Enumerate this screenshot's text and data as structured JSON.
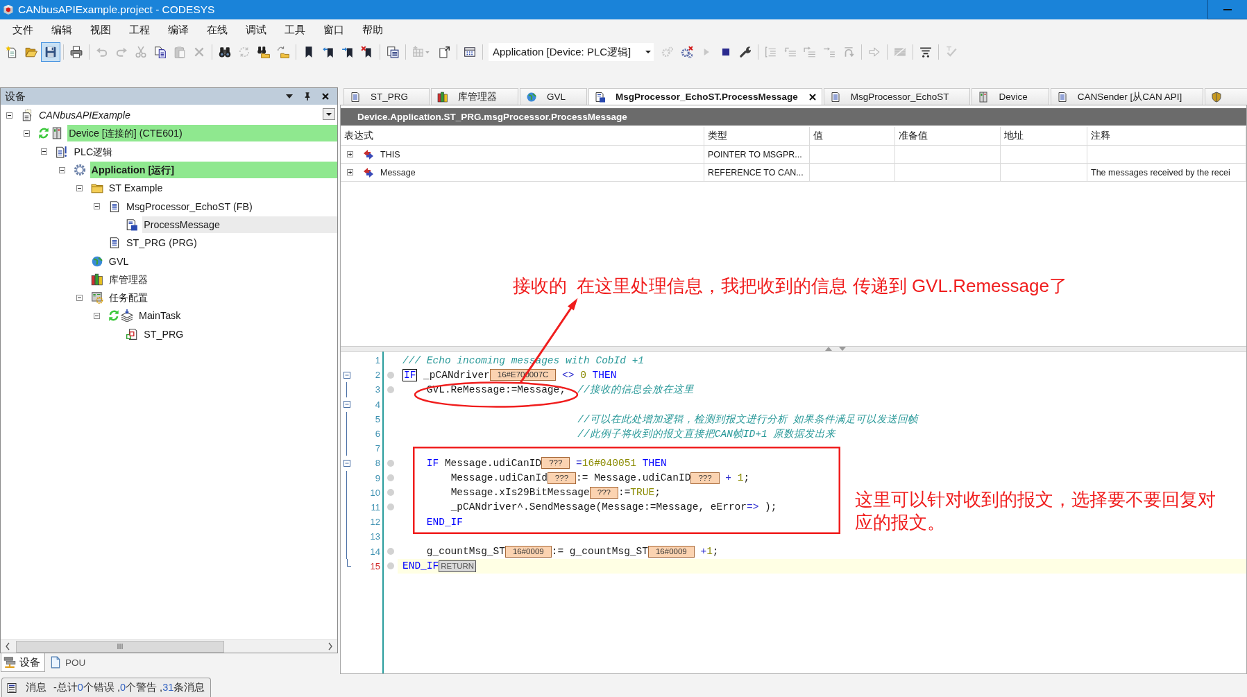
{
  "window": {
    "title": "CANbusAPIExample.project - CODESYS"
  },
  "menu": [
    "文件",
    "编辑",
    "视图",
    "工程",
    "编译",
    "在线",
    "调试",
    "工具",
    "窗口",
    "帮助"
  ],
  "toolbar": {
    "groups_left": [
      [
        {
          "disabled": false,
          "hovered": false
        },
        {
          "disabled": false,
          "hovered": false
        },
        {
          "disabled": false,
          "hovered": true
        }
      ],
      [
        {
          "disabled": false,
          "hovered": false
        }
      ],
      [
        {
          "disabled": true,
          "hovered": false
        },
        {
          "disabled": true,
          "hovered": false
        },
        {
          "disabled": true,
          "hovered": false
        },
        {
          "disabled": false,
          "hovered": false
        },
        {
          "disabled": true,
          "hovered": false
        },
        {
          "disabled": true,
          "hovered": false
        }
      ],
      [
        {
          "disabled": false,
          "hovered": false
        },
        {
          "disabled": true,
          "hovered": false
        },
        {
          "disabled": false,
          "hovered": false
        },
        {
          "disabled": false,
          "hovered": false
        }
      ],
      [
        {
          "disabled": false,
          "hovered": false
        },
        {
          "disabled": false,
          "hovered": false
        },
        {
          "disabled": false,
          "hovered": false
        },
        {
          "disabled": false,
          "hovered": false
        }
      ],
      [
        {
          "disabled": false,
          "hovered": false
        }
      ],
      [
        {
          "disabled": true,
          "hovered": false
        },
        {
          "disabled": false,
          "hovered": false
        }
      ],
      [
        {
          "disabled": false,
          "hovered": false
        }
      ]
    ],
    "application_selector": "Application [Device: PLC逻辑]",
    "groups_right": [
      [
        {
          "disabled": true,
          "hovered": false
        },
        {
          "disabled": false,
          "hovered": false
        },
        {
          "disabled": true,
          "hovered": false
        },
        {
          "disabled": false,
          "hovered": false
        },
        {
          "disabled": false,
          "hovered": false
        }
      ],
      [
        {
          "disabled": true,
          "hovered": false
        },
        {
          "disabled": true,
          "hovered": false
        },
        {
          "disabled": true,
          "hovered": false
        },
        {
          "disabled": true,
          "hovered": false
        },
        {
          "disabled": true,
          "hovered": false
        }
      ],
      [
        {
          "disabled": true,
          "hovered": false
        }
      ],
      [
        {
          "disabled": true,
          "hovered": false
        }
      ],
      [
        {
          "disabled": false,
          "hovered": false
        }
      ],
      [
        {
          "disabled": true,
          "hovered": false
        }
      ]
    ]
  },
  "devices_panel": {
    "title": "设备",
    "tree": [
      {
        "label": "CANbusAPIExample",
        "kind": "project",
        "expanded": true,
        "online": false,
        "highlighted": false,
        "selected": false,
        "children": [
          {
            "label": "Device [连接的] (CTE601)",
            "kind": "device",
            "expanded": true,
            "online": true,
            "highlighted": true,
            "selected": false,
            "children": [
              {
                "label": "PLC逻辑",
                "kind": "plc-logic",
                "expanded": true,
                "online": false,
                "highlighted": false,
                "selected": false,
                "children": [
                  {
                    "label": "Application [运行]",
                    "kind": "application",
                    "expanded": true,
                    "online": false,
                    "highlighted": true,
                    "selected": false,
                    "children": [
                      {
                        "label": "ST Example",
                        "kind": "folder",
                        "expanded": true,
                        "online": false,
                        "highlighted": false,
                        "selected": false,
                        "children": [
                          {
                            "label": "MsgProcessor_EchoST (FB)",
                            "kind": "pou",
                            "expanded": true,
                            "online": false,
                            "highlighted": false,
                            "selected": false,
                            "children": [
                              {
                                "label": "ProcessMessage",
                                "kind": "method",
                                "online": false,
                                "highlighted": false,
                                "selected": true
                              }
                            ]
                          },
                          {
                            "label": "ST_PRG (PRG)",
                            "kind": "pou",
                            "online": false,
                            "highlighted": false,
                            "selected": false
                          }
                        ]
                      },
                      {
                        "label": "GVL",
                        "kind": "gvl",
                        "online": false,
                        "highlighted": false,
                        "selected": false
                      },
                      {
                        "label": "库管理器",
                        "kind": "library",
                        "online": false,
                        "highlighted": false,
                        "selected": false
                      },
                      {
                        "label": "任务配置",
                        "kind": "task-config",
                        "expanded": true,
                        "online": false,
                        "highlighted": false,
                        "selected": false,
                        "children": [
                          {
                            "label": "MainTask",
                            "kind": "task",
                            "expanded": true,
                            "online": true,
                            "highlighted": false,
                            "selected": false,
                            "children": [
                              {
                                "label": "ST_PRG",
                                "kind": "program-call",
                                "online": false,
                                "highlighted": false,
                                "selected": false
                              }
                            ]
                          }
                        ]
                      }
                    ]
                  }
                ]
              }
            ]
          }
        ]
      }
    ]
  },
  "panel_tabs": [
    {
      "label": "设备",
      "selected": true
    },
    {
      "label": "POU",
      "selected": false
    }
  ],
  "messages_tab": {
    "label": "消息",
    "summary": [
      {
        "kind": "text",
        "text": "-总计"
      },
      {
        "kind": "count",
        "text": "0"
      },
      {
        "kind": "text",
        "text": "个错误 ,"
      },
      {
        "kind": "count",
        "text": "0"
      },
      {
        "kind": "text",
        "text": "个警告 ,"
      },
      {
        "kind": "count",
        "text": "31"
      },
      {
        "kind": "text",
        "text": "条消息"
      }
    ]
  },
  "editor": {
    "tabs": [
      {
        "label": "ST_PRG",
        "kind": "pou",
        "selected": false
      },
      {
        "label": "库管理器",
        "kind": "library",
        "selected": false
      },
      {
        "label": "GVL",
        "kind": "gvl",
        "selected": false
      },
      {
        "label": "MsgProcessor_EchoST.ProcessMessage",
        "kind": "method",
        "selected": true
      },
      {
        "label": "MsgProcessor_EchoST",
        "kind": "pou",
        "selected": false
      },
      {
        "label": "Device",
        "kind": "device",
        "selected": false
      },
      {
        "label": "CANSender [从CAN API]",
        "kind": "pou",
        "selected": false
      },
      {
        "kind": "shield",
        "selected": false
      }
    ],
    "path": "Device.Application.ST_PRG.msgProcessor.ProcessMessage",
    "watch_table": {
      "columns": [
        "表达式",
        "类型",
        "值",
        "准备值",
        "地址",
        "注释"
      ],
      "rows": [
        {
          "expanded": false,
          "expression": "THIS",
          "type": "POINTER TO MSGPR..."
        },
        {
          "expanded": false,
          "expression": "Message",
          "type": "REFERENCE TO CAN...",
          "comment": "The messages received by the recei"
        }
      ]
    },
    "code_lines": [
      {
        "number": "1",
        "kind": "plain",
        "current": false,
        "breakpoint_slot": false,
        "tokens": [
          {
            "kind": "comment",
            "text": "/// Echo incoming messages with CobId +1"
          }
        ]
      },
      {
        "number": "2",
        "kind": "opener",
        "current": false,
        "breakpoint_slot": true,
        "tokens": [
          {
            "kind": "keyword-match",
            "text": "IF"
          },
          {
            "kind": "text",
            "text": " _pCANdriver"
          },
          {
            "kind": "monitor",
            "text": "16#E700007C"
          },
          {
            "kind": "operator",
            "text": " <>"
          },
          {
            "kind": "literal",
            "text": " 0"
          },
          {
            "kind": "keyword",
            "text": " THEN"
          }
        ]
      },
      {
        "number": "3",
        "kind": "inner",
        "current": false,
        "breakpoint_slot": true,
        "tokens": [
          {
            "kind": "text",
            "text": "    GVL.ReMessage:=Message;"
          },
          {
            "kind": "comment",
            "text": "  //接收的信息会放在这里"
          }
        ]
      },
      {
        "number": "4",
        "kind": "opener",
        "current": false,
        "breakpoint_slot": false
      },
      {
        "number": "5",
        "kind": "inner",
        "current": false,
        "breakpoint_slot": false,
        "tokens": [
          {
            "kind": "comment",
            "text": "                             //可以在此处增加逻辑，检测到报文进行分析 如果条件满足可以发送回帧"
          }
        ]
      },
      {
        "number": "6",
        "kind": "inner",
        "current": false,
        "breakpoint_slot": false,
        "tokens": [
          {
            "kind": "comment",
            "text": "                             //此例子将收到的报文直接把CAN帧ID+1 原数据发出来"
          }
        ]
      },
      {
        "number": "7",
        "kind": "inner",
        "current": false,
        "breakpoint_slot": false
      },
      {
        "number": "8",
        "kind": "opener",
        "current": false,
        "breakpoint_slot": true,
        "tokens": [
          {
            "kind": "keyword",
            "text": "    IF"
          },
          {
            "kind": "text",
            "text": " Message.udiCanID"
          },
          {
            "kind": "monitor",
            "text": "???"
          },
          {
            "kind": "operator",
            "text": " ="
          },
          {
            "kind": "literal",
            "text": "16#040051"
          },
          {
            "kind": "keyword",
            "text": " THEN"
          }
        ]
      },
      {
        "number": "9",
        "kind": "inner",
        "current": false,
        "breakpoint_slot": true,
        "tokens": [
          {
            "kind": "text",
            "text": "        Message.udiCanId"
          },
          {
            "kind": "monitor",
            "text": "???"
          },
          {
            "kind": "text",
            "text": ":= Message.udiCanID"
          },
          {
            "kind": "monitor",
            "text": "???"
          },
          {
            "kind": "operator",
            "text": " +"
          },
          {
            "kind": "literal",
            "text": " 1"
          },
          {
            "kind": "text",
            "text": ";"
          }
        ]
      },
      {
        "number": "10",
        "kind": "inner",
        "current": false,
        "breakpoint_slot": true,
        "tokens": [
          {
            "kind": "text",
            "text": "        Message.xIs29BitMessage"
          },
          {
            "kind": "monitor",
            "text": "???"
          },
          {
            "kind": "text",
            "text": ":="
          },
          {
            "kind": "literal",
            "text": "TRUE"
          },
          {
            "kind": "text",
            "text": ";"
          }
        ]
      },
      {
        "number": "11",
        "kind": "inner",
        "current": false,
        "breakpoint_slot": true,
        "tokens": [
          {
            "kind": "text",
            "text": "        _pCANdriver^.SendMessage(Message:=Message, eError"
          },
          {
            "kind": "operator",
            "text": "=>"
          },
          {
            "kind": "text",
            "text": " );"
          }
        ]
      },
      {
        "number": "12",
        "kind": "inner",
        "current": false,
        "breakpoint_slot": false,
        "tokens": [
          {
            "kind": "keyword",
            "text": "    END_IF"
          }
        ]
      },
      {
        "number": "13",
        "kind": "inner",
        "current": false,
        "breakpoint_slot": false
      },
      {
        "number": "14",
        "kind": "inner",
        "current": false,
        "breakpoint_slot": true,
        "tokens": [
          {
            "kind": "text",
            "text": "    g_countMsg_ST"
          },
          {
            "kind": "monitor",
            "text": "16#0009"
          },
          {
            "kind": "text",
            "text": ":= g_countMsg_ST"
          },
          {
            "kind": "monitor",
            "text": "16#0009"
          },
          {
            "kind": "operator",
            "text": " +"
          },
          {
            "kind": "literal",
            "text": "1"
          },
          {
            "kind": "text",
            "text": ";"
          }
        ]
      },
      {
        "number": "15",
        "kind": "closer",
        "current": true,
        "breakpoint_slot": true,
        "tokens": [
          {
            "kind": "keyword",
            "text": "END_IF"
          },
          {
            "kind": "return",
            "text": "RETURN"
          }
        ]
      }
    ]
  },
  "annotations": {
    "upper_note": "接收的  在这里处理信息，我把收到的信息 传递到 GVL.Remessage了",
    "side_note": "这里可以针对收到的报文，选择要不要回复对应的报文。"
  }
}
